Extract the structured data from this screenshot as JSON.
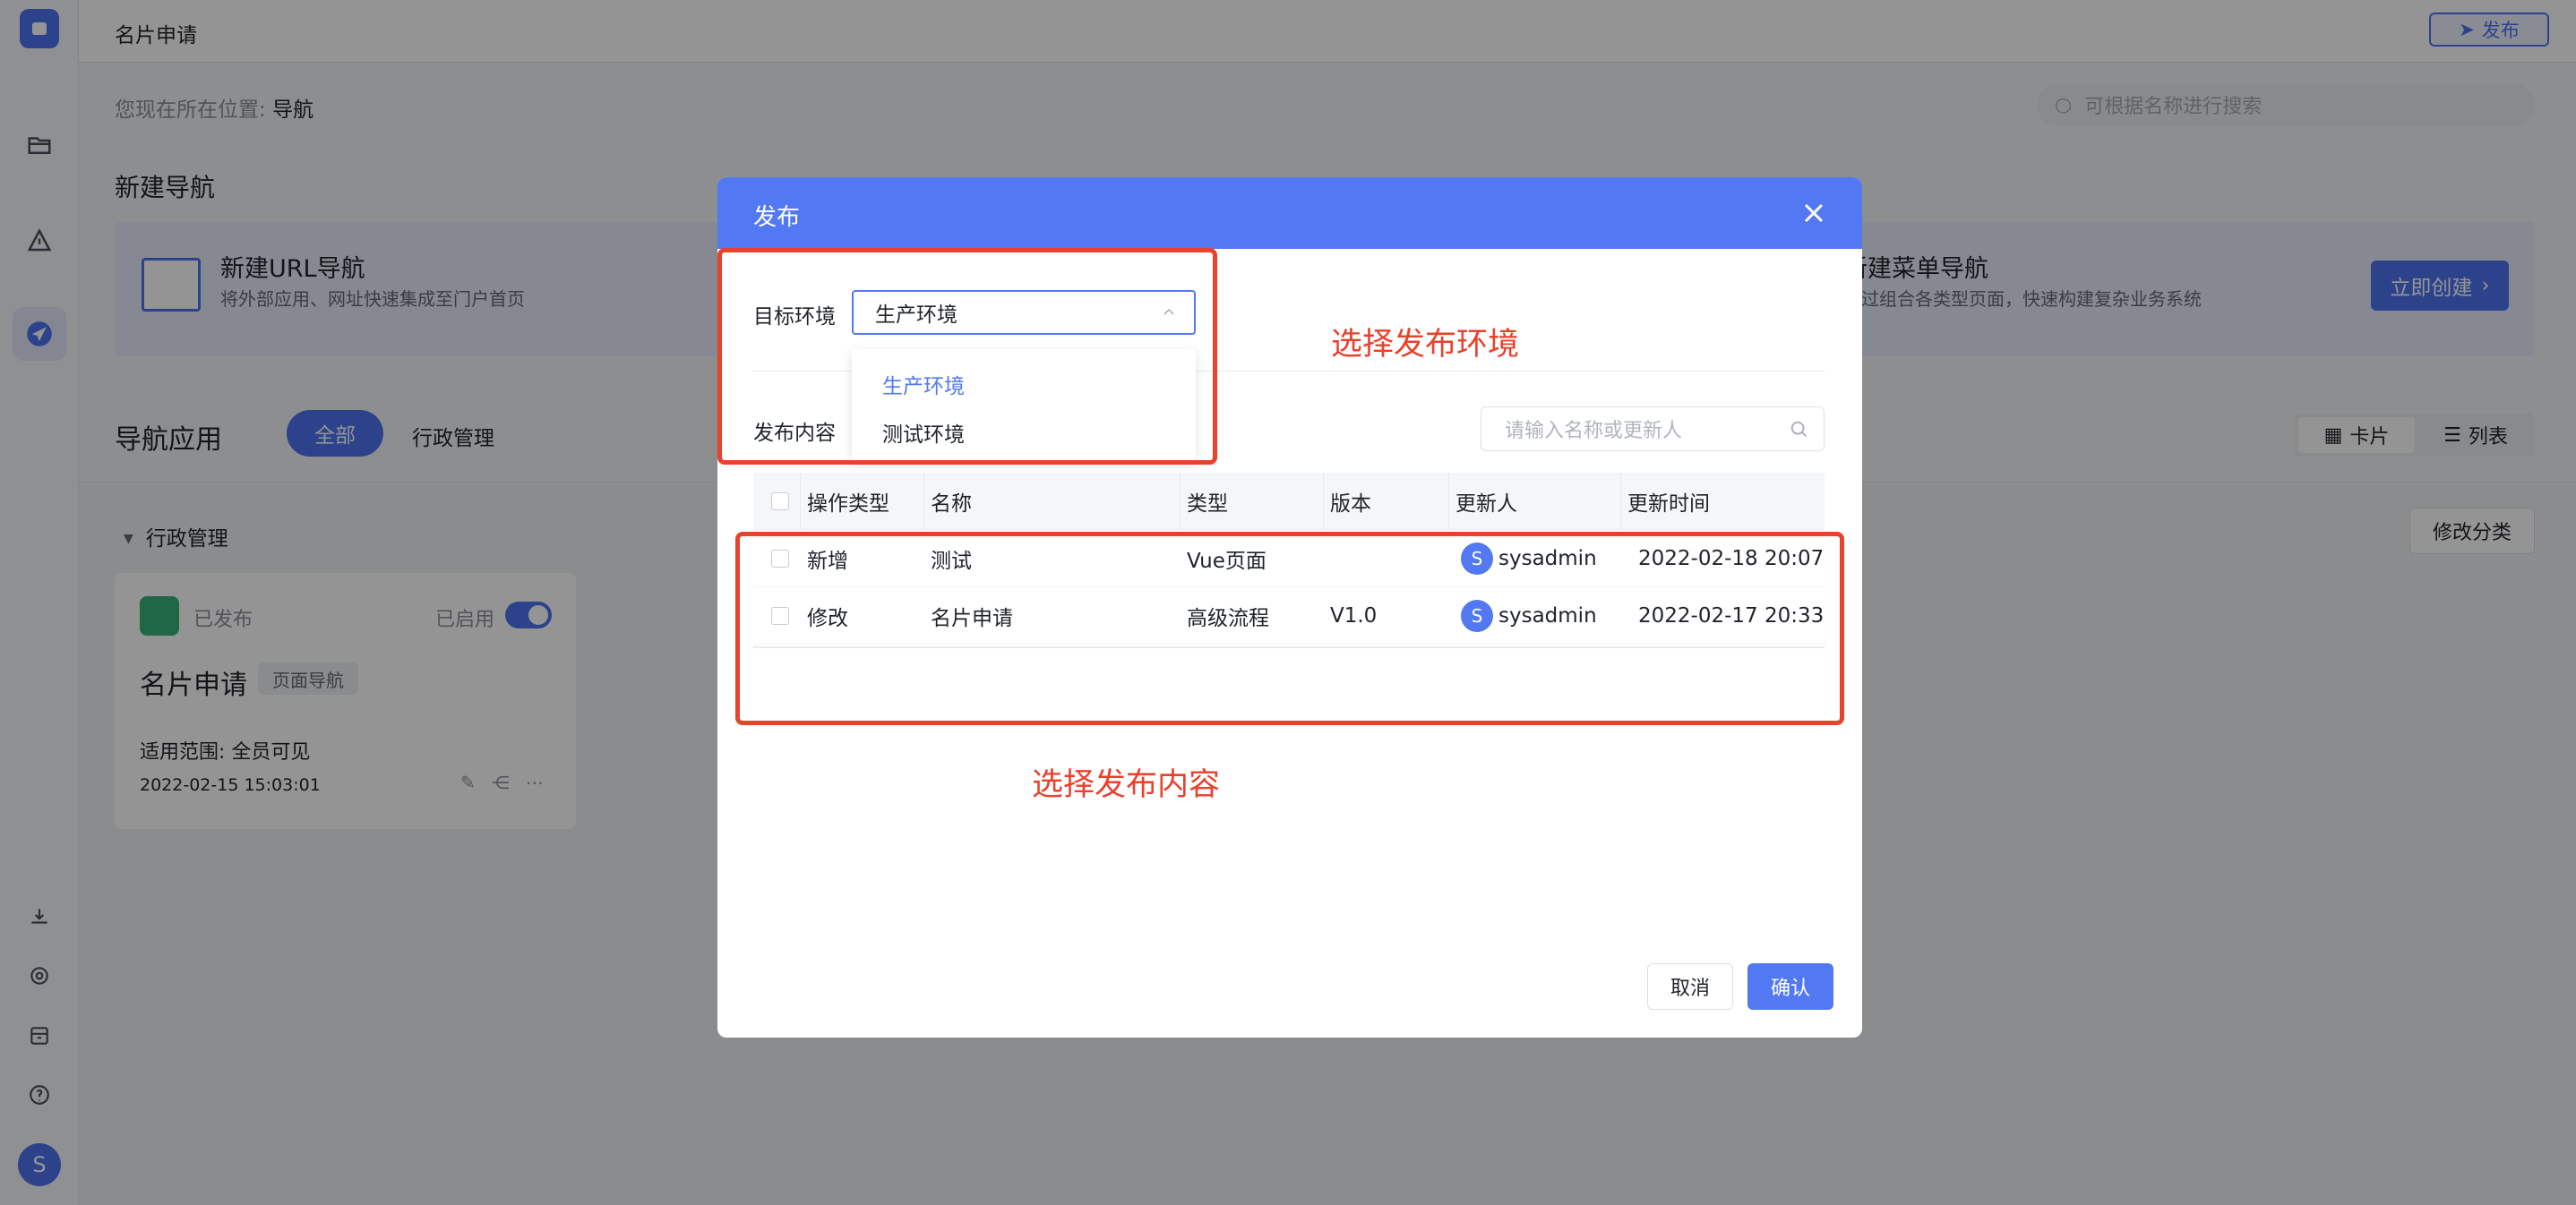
{
  "app": {
    "page_title": "名片申请",
    "publish_label": "发布"
  },
  "location": {
    "prefix": "您现在所在位置:",
    "current": "导航"
  },
  "search": {
    "placeholder": "可根据名称进行搜索"
  },
  "new_nav": {
    "heading": "新建导航",
    "url": {
      "title": "新建URL导航",
      "desc": "将外部应用、网址快速集成至门户首页"
    },
    "menu": {
      "title": "新建菜单导航",
      "desc": "通过组合各类型页面，快速构建复杂业务系统"
    },
    "create_label": "立即创建"
  },
  "apps": {
    "heading": "导航应用",
    "filters": [
      "全部",
      "行政管理"
    ],
    "view_card": "卡片",
    "view_list": "列表",
    "group": "行政管理",
    "modify_label": "修改分类"
  },
  "card": {
    "status": "已发布",
    "enabled": "已启用",
    "name": "名片申请",
    "tag": "页面导航",
    "scope": "适用范围: 全员可见",
    "date": "2022-02-15 15:03:01"
  },
  "modal": {
    "title": "发布",
    "target_label": "目标环境",
    "target_value": "生产环境",
    "options": [
      "生产环境",
      "测试环境"
    ],
    "content_label": "发布内容",
    "search_placeholder": "请输入名称或更新人",
    "columns": [
      "操作类型",
      "名称",
      "类型",
      "版本",
      "更新人",
      "更新时间"
    ],
    "rows": [
      {
        "op": "新增",
        "name": "测试",
        "type": "Vue页面",
        "version": "",
        "avatar": "S",
        "user": "sysadmin",
        "time": "2022-02-18 20:07"
      },
      {
        "op": "修改",
        "name": "名片申请",
        "type": "高级流程",
        "version": "V1.0",
        "avatar": "S",
        "user": "sysadmin",
        "time": "2022-02-17 20:33"
      }
    ],
    "cancel_label": "取消",
    "confirm_label": "确认"
  },
  "annotations": {
    "env": "选择发布环境",
    "content": "选择发布内容"
  },
  "user": {
    "avatar": "S"
  },
  "colors": {
    "accent": "#4d73f0",
    "annotation": "#e8412c",
    "success": "#38b27a"
  },
  "icons": [
    "logo-icon",
    "folder-icon",
    "warning-icon",
    "navigation-icon",
    "download-icon",
    "gear-icon",
    "archive-icon",
    "help-icon",
    "send-icon",
    "search-icon",
    "close-icon",
    "chevron-up-icon",
    "chevron-right-icon",
    "grid-icon",
    "list-icon",
    "edit-icon",
    "share-icon",
    "more-icon"
  ]
}
